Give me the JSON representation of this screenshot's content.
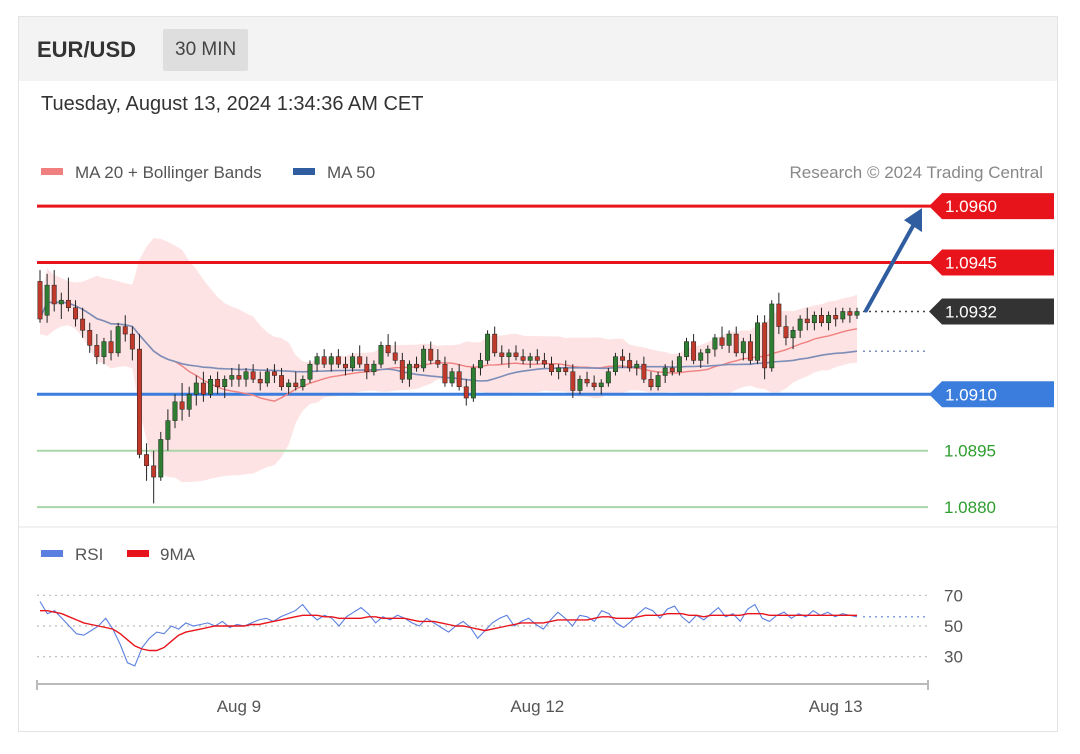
{
  "header": {
    "symbol": "EUR/USD",
    "timeframe": "30 MIN"
  },
  "timestamp": "Tuesday, August 13, 2024 1:34:36 AM CET",
  "legend": {
    "ma20_label": "MA 20 + Bollinger Bands",
    "ma50_label": "MA 50",
    "copyright": "Research © 2024 Trading Central",
    "rsi_label": "RSI",
    "ma9_label": "9MA"
  },
  "colors": {
    "resistance": "#e8141b",
    "support": "#3b7ddd",
    "pivot_green": "#2e9e2e",
    "bull_candle": "#2e7d32",
    "bear_candle": "#c0392b",
    "bollinger_fill": "#fde0e0",
    "ma20": "#f08080",
    "ma50": "#7b8db8",
    "arrow": "#2f5da0",
    "rsi": "#5b7fe0",
    "ma9": "#e8141b"
  },
  "chart_data": [
    {
      "type": "candlestick",
      "title": "EUR/USD 30 MIN",
      "x_ticks": [
        "Aug 9",
        "Aug 12",
        "Aug 13"
      ],
      "ylim": [
        1.0875,
        1.0968
      ],
      "last_price": "1.0932",
      "levels": [
        {
          "value": "1.0960",
          "kind": "resistance"
        },
        {
          "value": "1.0945",
          "kind": "resistance"
        },
        {
          "value": "1.0910",
          "kind": "support"
        },
        {
          "value": "1.0895",
          "kind": "pivot"
        },
        {
          "value": "1.0880",
          "kind": "pivot"
        }
      ],
      "target_arrow": {
        "from": 1.0932,
        "to": 1.096
      },
      "candles": [
        [
          1.094,
          1.0943,
          1.0929,
          1.093
        ],
        [
          1.0931,
          1.0942,
          1.0929,
          1.0939
        ],
        [
          1.0939,
          1.0943,
          1.0932,
          1.0934
        ],
        [
          1.0934,
          1.0937,
          1.093,
          1.0935
        ],
        [
          1.0935,
          1.0941,
          1.0932,
          1.0933
        ],
        [
          1.0933,
          1.0935,
          1.0928,
          1.093
        ],
        [
          1.093,
          1.0933,
          1.0925,
          1.0927
        ],
        [
          1.0927,
          1.0929,
          1.0921,
          1.0923
        ],
        [
          1.0923,
          1.0926,
          1.0918,
          1.092
        ],
        [
          1.092,
          1.0925,
          1.0918,
          1.0924
        ],
        [
          1.0924,
          1.0927,
          1.0919,
          1.0921
        ],
        [
          1.0921,
          1.0929,
          1.092,
          1.0928
        ],
        [
          1.0928,
          1.0931,
          1.0924,
          1.0926
        ],
        [
          1.0926,
          1.0928,
          1.0919,
          1.0922
        ],
        [
          1.0922,
          1.0926,
          1.0893,
          1.0894
        ],
        [
          1.0894,
          1.0897,
          1.0887,
          1.0891
        ],
        [
          1.0891,
          1.0895,
          1.0881,
          1.0888
        ],
        [
          1.0888,
          1.09,
          1.0887,
          1.0898
        ],
        [
          1.0898,
          1.0906,
          1.0895,
          1.0903
        ],
        [
          1.0903,
          1.091,
          1.0901,
          1.0908
        ],
        [
          1.0908,
          1.0913,
          1.0903,
          1.0906
        ],
        [
          1.0906,
          1.0912,
          1.0904,
          1.091
        ],
        [
          1.091,
          1.0915,
          1.0907,
          1.0913
        ],
        [
          1.0913,
          1.0916,
          1.0908,
          1.091
        ],
        [
          1.091,
          1.0915,
          1.0909,
          1.0914
        ],
        [
          1.0914,
          1.0916,
          1.091,
          1.0912
        ],
        [
          1.0912,
          1.0915,
          1.0909,
          1.0914
        ],
        [
          1.0914,
          1.0917,
          1.0912,
          1.0915
        ],
        [
          1.0915,
          1.0918,
          1.0912,
          1.0914
        ],
        [
          1.0914,
          1.0917,
          1.0912,
          1.0916
        ],
        [
          1.0916,
          1.0918,
          1.0913,
          1.0914
        ],
        [
          1.0914,
          1.0916,
          1.0911,
          1.0913
        ],
        [
          1.0913,
          1.0917,
          1.0912,
          1.0916
        ],
        [
          1.0916,
          1.0918,
          1.0913,
          1.0915
        ],
        [
          1.0915,
          1.0917,
          1.0911,
          1.0912
        ],
        [
          1.0912,
          1.0914,
          1.091,
          1.0913
        ],
        [
          1.0913,
          1.0916,
          1.0911,
          1.0912
        ],
        [
          1.0912,
          1.0915,
          1.0911,
          1.0914
        ],
        [
          1.0914,
          1.0919,
          1.0913,
          1.0918
        ],
        [
          1.0918,
          1.0921,
          1.0916,
          1.092
        ],
        [
          1.092,
          1.0922,
          1.0917,
          1.0918
        ],
        [
          1.0918,
          1.0921,
          1.0916,
          1.092
        ],
        [
          1.092,
          1.0922,
          1.0917,
          1.0918
        ],
        [
          1.0918,
          1.092,
          1.0915,
          1.0917
        ],
        [
          1.0917,
          1.0921,
          1.0916,
          1.092
        ],
        [
          1.092,
          1.0923,
          1.0917,
          1.0918
        ],
        [
          1.0918,
          1.092,
          1.0914,
          1.0916
        ],
        [
          1.0916,
          1.0919,
          1.0915,
          1.0918
        ],
        [
          1.0918,
          1.0924,
          1.0917,
          1.0923
        ],
        [
          1.0923,
          1.0926,
          1.092,
          1.0921
        ],
        [
          1.0921,
          1.0924,
          1.0918,
          1.0919
        ],
        [
          1.0919,
          1.0921,
          1.0913,
          1.0914
        ],
        [
          1.0914,
          1.0919,
          1.0912,
          1.0918
        ],
        [
          1.0918,
          1.092,
          1.0916,
          1.0917
        ],
        [
          1.0917,
          1.0923,
          1.0916,
          1.0922
        ],
        [
          1.0922,
          1.0924,
          1.0918,
          1.0919
        ],
        [
          1.0919,
          1.0922,
          1.0917,
          1.0918
        ],
        [
          1.0918,
          1.092,
          1.0912,
          1.0913
        ],
        [
          1.0913,
          1.0917,
          1.0912,
          1.0916
        ],
        [
          1.0916,
          1.0918,
          1.0911,
          1.0912
        ],
        [
          1.0912,
          1.0914,
          1.0907,
          1.0909
        ],
        [
          1.0909,
          1.0918,
          1.0908,
          1.0917
        ],
        [
          1.0917,
          1.0921,
          1.0915,
          1.0919
        ],
        [
          1.0919,
          1.0927,
          1.0918,
          1.0926
        ],
        [
          1.0926,
          1.0928,
          1.092,
          1.0921
        ],
        [
          1.0921,
          1.0923,
          1.0918,
          1.092
        ],
        [
          1.092,
          1.0922,
          1.0917,
          1.0921
        ],
        [
          1.0921,
          1.0923,
          1.0919,
          1.092
        ],
        [
          1.092,
          1.0922,
          1.0918,
          1.0919
        ],
        [
          1.0919,
          1.0921,
          1.0917,
          1.092
        ],
        [
          1.092,
          1.0922,
          1.0918,
          1.0919
        ],
        [
          1.0919,
          1.0921,
          1.0917,
          1.0918
        ],
        [
          1.0918,
          1.092,
          1.0915,
          1.0916
        ],
        [
          1.0916,
          1.0918,
          1.0914,
          1.0917
        ],
        [
          1.0917,
          1.0919,
          1.0915,
          1.0916
        ],
        [
          1.0916,
          1.0918,
          1.0909,
          1.0911
        ],
        [
          1.0911,
          1.0915,
          1.091,
          1.0914
        ],
        [
          1.0914,
          1.0916,
          1.0912,
          1.0913
        ],
        [
          1.0913,
          1.0915,
          1.0911,
          1.0912
        ],
        [
          1.0912,
          1.0914,
          1.091,
          1.0913
        ],
        [
          1.0913,
          1.0917,
          1.0912,
          1.0916
        ],
        [
          1.0916,
          1.0921,
          1.0915,
          1.092
        ],
        [
          1.092,
          1.0922,
          1.0917,
          1.0919
        ],
        [
          1.0919,
          1.0921,
          1.0916,
          1.0917
        ],
        [
          1.0917,
          1.0919,
          1.0915,
          1.0918
        ],
        [
          1.0918,
          1.092,
          1.0913,
          1.0914
        ],
        [
          1.0914,
          1.0916,
          1.0911,
          1.0912
        ],
        [
          1.0912,
          1.0916,
          1.0911,
          1.0915
        ],
        [
          1.0915,
          1.0918,
          1.0913,
          1.0917
        ],
        [
          1.0917,
          1.0919,
          1.0915,
          1.0916
        ],
        [
          1.0916,
          1.0921,
          1.0915,
          1.092
        ],
        [
          1.092,
          1.0925,
          1.0919,
          1.0924
        ],
        [
          1.0924,
          1.0926,
          1.0918,
          1.0919
        ],
        [
          1.0919,
          1.0922,
          1.0917,
          1.0921
        ],
        [
          1.0921,
          1.0923,
          1.0918,
          1.0922
        ],
        [
          1.0922,
          1.0926,
          1.092,
          1.0925
        ],
        [
          1.0925,
          1.0928,
          1.0922,
          1.0923
        ],
        [
          1.0923,
          1.0927,
          1.0921,
          1.0926
        ],
        [
          1.0926,
          1.0928,
          1.092,
          1.0921
        ],
        [
          1.0921,
          1.0925,
          1.0919,
          1.0924
        ],
        [
          1.0924,
          1.0926,
          1.0918,
          1.0919
        ],
        [
          1.0919,
          1.0931,
          1.0918,
          1.0929
        ],
        [
          1.0929,
          1.0931,
          1.0914,
          1.0917
        ],
        [
          1.0917,
          1.0935,
          1.0916,
          1.0934
        ],
        [
          1.0934,
          1.0937,
          1.0926,
          1.0928
        ],
        [
          1.0928,
          1.0931,
          1.0923,
          1.0925
        ],
        [
          1.0925,
          1.0928,
          1.0922,
          1.0927
        ],
        [
          1.0927,
          1.0931,
          1.0925,
          1.093
        ],
        [
          1.093,
          1.0933,
          1.0927,
          1.0929
        ],
        [
          1.0929,
          1.0932,
          1.0927,
          1.0931
        ],
        [
          1.0931,
          1.0933,
          1.0928,
          1.0929
        ],
        [
          1.0929,
          1.0932,
          1.0927,
          1.0931
        ],
        [
          1.0931,
          1.0933,
          1.0928,
          1.093
        ],
        [
          1.093,
          1.0933,
          1.0929,
          1.0932
        ],
        [
          1.0932,
          1.0933,
          1.0929,
          1.0931
        ],
        [
          1.0931,
          1.0933,
          1.093,
          1.0932
        ]
      ]
    },
    {
      "type": "line",
      "title": "RSI",
      "ylim": [
        20,
        80
      ],
      "y_ticks": [
        "70",
        "50",
        "30"
      ],
      "series": [
        {
          "name": "RSI",
          "values": [
            66,
            58,
            60,
            55,
            50,
            45,
            44,
            47,
            50,
            55,
            48,
            38,
            26,
            24,
            36,
            42,
            46,
            45,
            50,
            48,
            52,
            50,
            51,
            52,
            50,
            53,
            49,
            51,
            50,
            52,
            54,
            55,
            53,
            56,
            58,
            60,
            64,
            58,
            54,
            57,
            55,
            50,
            56,
            59,
            62,
            58,
            52,
            56,
            54,
            57,
            55,
            52,
            50,
            55,
            52,
            49,
            46,
            50,
            53,
            49,
            42,
            47,
            52,
            55,
            57,
            50,
            53,
            55,
            51,
            48,
            54,
            59,
            55,
            50,
            57,
            56,
            53,
            60,
            58,
            52,
            49,
            53,
            58,
            62,
            60,
            55,
            61,
            63,
            56,
            52,
            57,
            54,
            58,
            62,
            56,
            58,
            53,
            61,
            64,
            55,
            53,
            57,
            59,
            55,
            58,
            56,
            60,
            57,
            59,
            56,
            58,
            57,
            56
          ]
        },
        {
          "name": "9MA",
          "values": [
            60,
            60,
            59,
            58,
            56,
            54,
            52,
            51,
            50,
            49,
            48,
            45,
            41,
            37,
            35,
            34,
            34,
            36,
            40,
            44,
            46,
            47,
            48,
            49,
            50,
            50,
            50,
            50,
            50,
            51,
            51,
            52,
            53,
            54,
            55,
            56,
            57,
            57,
            57,
            56,
            56,
            55,
            55,
            55,
            55,
            56,
            56,
            55,
            55,
            55,
            55,
            54,
            53,
            53,
            53,
            52,
            51,
            50,
            50,
            49,
            48,
            47,
            48,
            49,
            50,
            51,
            52,
            52,
            52,
            52,
            53,
            54,
            54,
            54,
            54,
            54,
            55,
            56,
            56,
            55,
            55,
            55,
            56,
            57,
            57,
            57,
            58,
            58,
            58,
            57,
            57,
            56,
            57,
            57,
            57,
            57,
            57,
            58,
            58,
            58,
            57,
            57,
            57,
            57,
            57,
            57,
            57,
            57,
            57,
            57,
            57,
            57,
            57
          ]
        }
      ]
    }
  ]
}
